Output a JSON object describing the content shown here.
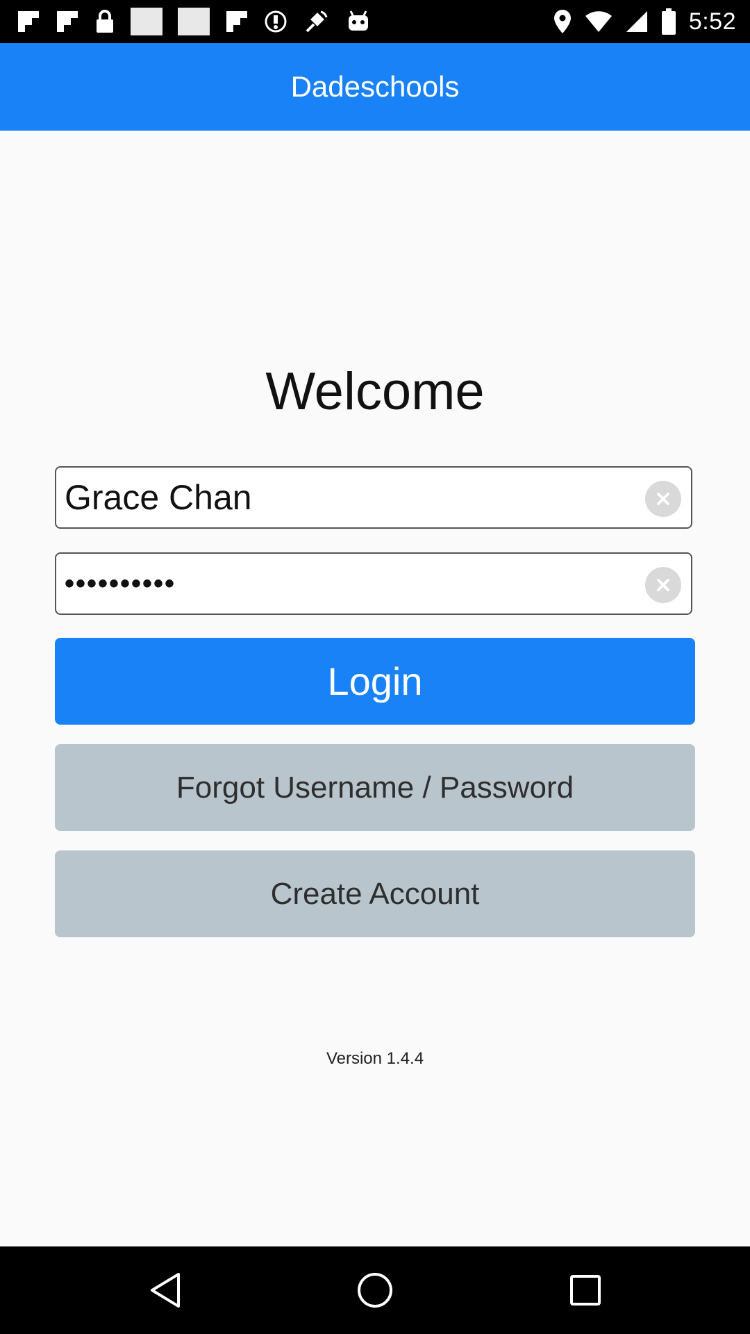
{
  "status_bar": {
    "time": "5:52",
    "left_icons": [
      "flipboard-icon",
      "flipboard-icon",
      "lock-icon",
      "white-rect-icon",
      "white-rect-icon",
      "flipboard-icon",
      "sync-icon",
      "fake-gps-icon",
      "android-icon"
    ],
    "right_icons": [
      "location-icon",
      "wifi-icon",
      "signal-icon",
      "battery-icon"
    ]
  },
  "header": {
    "title": "Dadeschools",
    "color": "#1a82f7"
  },
  "login_form": {
    "welcome": "Welcome",
    "username_value": "Grace Chan",
    "password_value": "••••••••••",
    "login_label": "Login",
    "forgot_label": "Forgot Username / Password",
    "create_label": "Create Account"
  },
  "footer": {
    "version": "Version 1.4.4"
  },
  "nav_bar": {
    "icons": [
      "back-icon",
      "home-icon",
      "recents-icon"
    ]
  }
}
